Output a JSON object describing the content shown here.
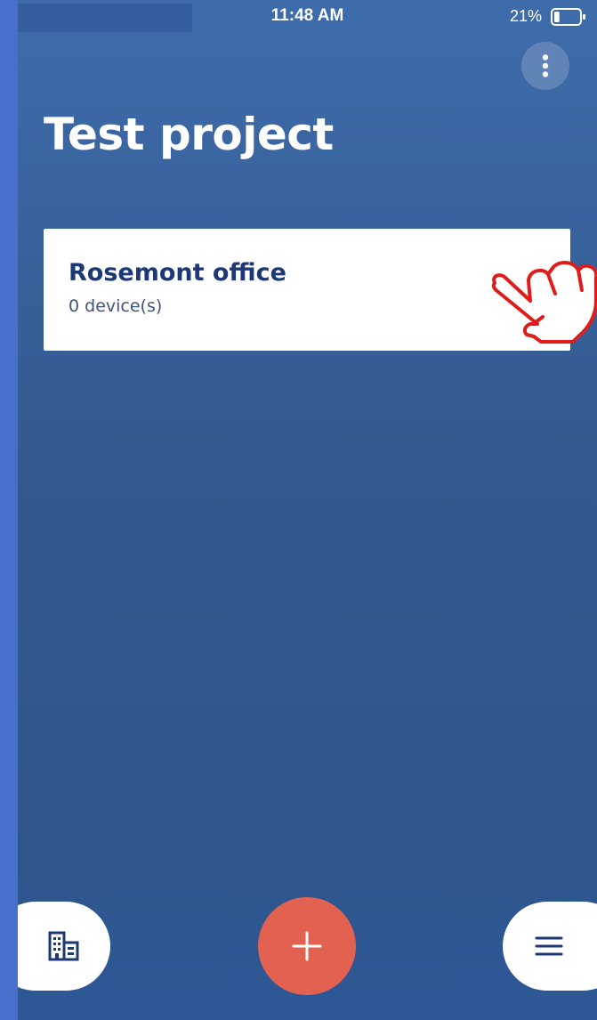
{
  "status_bar": {
    "time": "11:48 AM",
    "battery_percent": "21%",
    "battery_level": 0.21
  },
  "page": {
    "title": "Test project"
  },
  "locations": [
    {
      "name": "Rosemont office",
      "device_count_label": "0 device(s)"
    }
  ],
  "icons": {
    "more": "more-vertical-icon",
    "pointer": "hand-pointer-icon",
    "buildings": "buildings-icon",
    "add": "plus-icon",
    "menu": "hamburger-menu-icon"
  },
  "colors": {
    "background_top": "#3e6cab",
    "background_bottom": "#2d5797",
    "card": "#ffffff",
    "card_title": "#1d3875",
    "add_button": "#e26150",
    "icon_navy": "#1d3875",
    "pointer_red": "#e01b1b"
  }
}
